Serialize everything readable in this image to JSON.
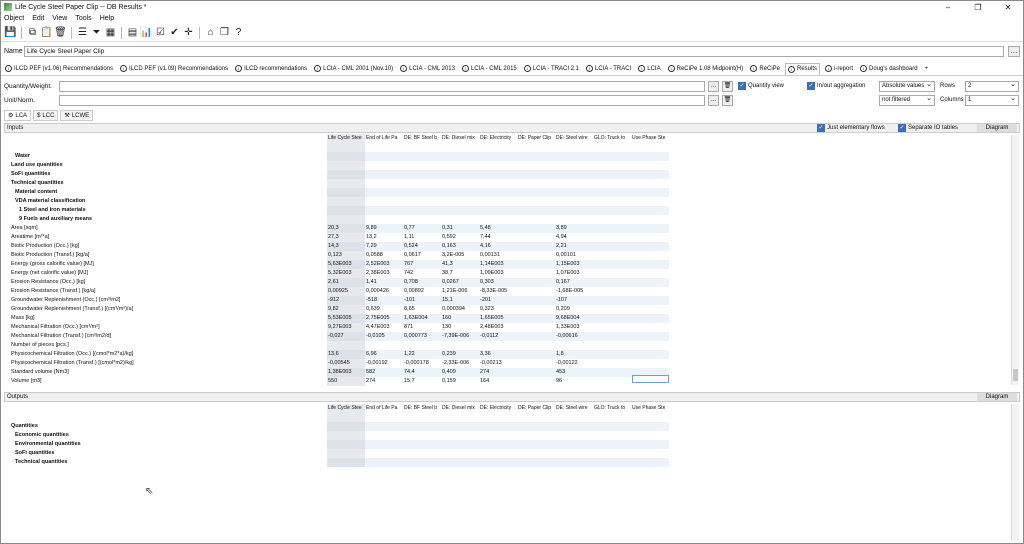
{
  "window": {
    "title": "Life Cycle Steel Paper Clip -- DB Results *",
    "controls": [
      "–",
      "❐",
      "✕"
    ]
  },
  "menu": [
    "Object",
    "Edit",
    "View",
    "Tools",
    "Help"
  ],
  "name": {
    "label": "Name",
    "value": "Life Cycle Steel Paper Clip",
    "btn": "…"
  },
  "tabs": [
    "ILCD PEF (v1.06) Recommendations",
    "ILCD PEF (v1.09) Recommendations",
    "ILCD recommendations",
    "LCIA - CML 2001 (Nov.10)",
    "LCIA - CML 2013",
    "LCIA - CML 2015",
    "LCIA - TRACI 2.1",
    "LCIA - TRACI",
    "LCIA",
    "ReCiPe 1.08 Midpoint(H)",
    "ReCiPe",
    "Results",
    "i-report",
    "Doug's dashboard"
  ],
  "tab_add": "+",
  "quantity": {
    "label": "Quantity/Weight.",
    "btn1": "...",
    "btn2": "🗑"
  },
  "unitnorm": {
    "label": "Unit/Norm.",
    "btn1": "...",
    "btn2": "🗑"
  },
  "options": {
    "quantity_view": "Quantity view",
    "infout": "In/out aggregation",
    "absolute": "Absolute values",
    "not_filtered": "not filtered",
    "rows_label": "Rows",
    "rows_value": "2",
    "cols_label": "Columns",
    "cols_value": "1"
  },
  "subtabs": [
    "LCA",
    "LCC",
    "LCWE"
  ],
  "inputs": {
    "title": "Inputs",
    "just_elementary": "Just elementary flows",
    "separate_io": "Separate IO tables",
    "diagram": "Diagram",
    "columns": [
      "Life Cycle Stee",
      "End of Life Pa",
      "DE: BF Steel b",
      "DE: Diesel mix",
      "DE: Electricity",
      "DE: Paper Clip",
      "DE: Steel wire",
      "GLO: Truck to",
      "Use Phase Ste"
    ],
    "rows": [
      {
        "label": "",
        "bold": false,
        "vals": []
      },
      {
        "label": "Water",
        "bold": true,
        "indent": 1,
        "vals": []
      },
      {
        "label": "Land use quantities",
        "bold": true,
        "vals": []
      },
      {
        "label": "SoFi quantities",
        "bold": true,
        "vals": []
      },
      {
        "label": "Technical quantities",
        "bold": true,
        "vals": []
      },
      {
        "label": "Material content",
        "bold": true,
        "indent": 1,
        "vals": []
      },
      {
        "label": "VDA material classification",
        "bold": true,
        "indent": 1,
        "vals": []
      },
      {
        "label": "1 Steel and iron materials",
        "bold": true,
        "indent": 2,
        "vals": []
      },
      {
        "label": "9 Fuels and auxiliary means",
        "bold": true,
        "indent": 2,
        "vals": []
      },
      {
        "label": "Area [sqm]",
        "vals": [
          "20,3",
          "9,89",
          "0,77",
          "0,31",
          "5,48",
          "",
          "3,89",
          "",
          ""
        ]
      },
      {
        "label": "Areatime [m²*a]",
        "vals": [
          "27,3",
          "13,2",
          "1,11",
          "0,592",
          "7,44",
          "",
          "4,94",
          "",
          ""
        ]
      },
      {
        "label": "Biotic Production (Occ.) [kg]",
        "vals": [
          "14,3",
          "7,29",
          "0,524",
          "0,163",
          "4,16",
          "",
          "2,21",
          "",
          ""
        ]
      },
      {
        "label": "Biotic Production (Transf.) [kg/a]",
        "vals": [
          "0,123",
          "0,0588",
          "0,0617",
          "3,2E-005",
          "0,00131",
          "",
          "0,00101",
          "",
          ""
        ]
      },
      {
        "label": "Energy (gross calorific value) [MJ]",
        "vals": [
          "5,63E003",
          "2,52E003",
          "767",
          "41,3",
          "1,14E003",
          "",
          "1,15E003",
          "",
          ""
        ]
      },
      {
        "label": "Energy (net calorific value) [MJ]",
        "vals": [
          "5,32E003",
          "2,38E003",
          "742",
          "38,7",
          "1,09E003",
          "",
          "1,07E003",
          "",
          ""
        ]
      },
      {
        "label": "Erosion Resistance (Occ.) [kg]",
        "vals": [
          "2,61",
          "1,41",
          "0,708",
          "0,0267",
          "0,303",
          "",
          "0,167",
          "",
          ""
        ]
      },
      {
        "label": "Erosion Resistance (Transf.) [kg/a]",
        "vals": [
          "0,00925",
          "0,000426",
          "0,00892",
          "1,21E-006",
          "-8,33E-005",
          "",
          "-1,68E-005",
          "",
          ""
        ]
      },
      {
        "label": "Groundwater Replenishment (Occ.) [cm³/m2]",
        "vals": [
          "-912",
          "-518",
          "-101",
          "15,1",
          "-201",
          "",
          "-107",
          "",
          ""
        ]
      },
      {
        "label": "Groundwater Replenishment (Transf.) [(cm³/m²)/a]",
        "vals": [
          "9,82",
          "0,639",
          "8,65",
          "0,000394",
          "0,323",
          "",
          "0,209",
          "",
          ""
        ]
      },
      {
        "label": "Mass [kg]",
        "vals": [
          "5,53E005",
          "2,75E005",
          "1,63E004",
          "160",
          "1,65E005",
          "",
          "9,68E004",
          "",
          ""
        ]
      },
      {
        "label": "Mechanical Filtration (Occ.) [cm³/m²]",
        "vals": [
          "9,27E003",
          "4,47E003",
          "871",
          "130",
          "2,48E003",
          "",
          "1,33E003",
          "",
          ""
        ]
      },
      {
        "label": "Mechanical Filtration (Transf.) [cm³/m2/d]",
        "vals": [
          "-0,027",
          "-0,0105",
          "0,000773",
          "-7,39E-006",
          "-0,0112",
          "",
          "-0,00616",
          "",
          ""
        ]
      },
      {
        "label": "Number of pieces [pcs.]",
        "vals": []
      },
      {
        "label": "Physicochemical Filtration (Occ.) [(cmol*m2*a)/kg]",
        "vals": [
          "13,6",
          "6,96",
          "1,22",
          "0,239",
          "3,36",
          "",
          "1,8",
          "",
          ""
        ]
      },
      {
        "label": "Physicochemical Filtration (Transf.) [(cmol*m2)/kg]",
        "vals": [
          "-0,00545",
          "-0,00192",
          "-0,000178",
          "-2,33E-006",
          "-0,00213",
          "",
          "-0,00122",
          "",
          ""
        ]
      },
      {
        "label": "Standard volume [Nm3]",
        "vals": [
          "1,38E003",
          "582",
          "74,4",
          "0,409",
          "274",
          "",
          "453",
          "",
          ""
        ]
      },
      {
        "label": "Volume [m3]",
        "vals": [
          "550",
          "274",
          "15,7",
          "0,159",
          "164",
          "",
          "96",
          "",
          ""
        ]
      }
    ]
  },
  "outputs": {
    "title": "Outputs",
    "diagram": "Diagram",
    "rows": [
      {
        "label": "",
        "bold": false
      },
      {
        "label": "Quantities",
        "bold": true
      },
      {
        "label": "Economic quantities",
        "bold": true,
        "indent": 1
      },
      {
        "label": "Environmental quantities",
        "bold": true,
        "indent": 1
      },
      {
        "label": "SoFi quantities",
        "bold": true,
        "indent": 1
      },
      {
        "label": "Technical quantities",
        "bold": true,
        "indent": 1
      }
    ]
  }
}
